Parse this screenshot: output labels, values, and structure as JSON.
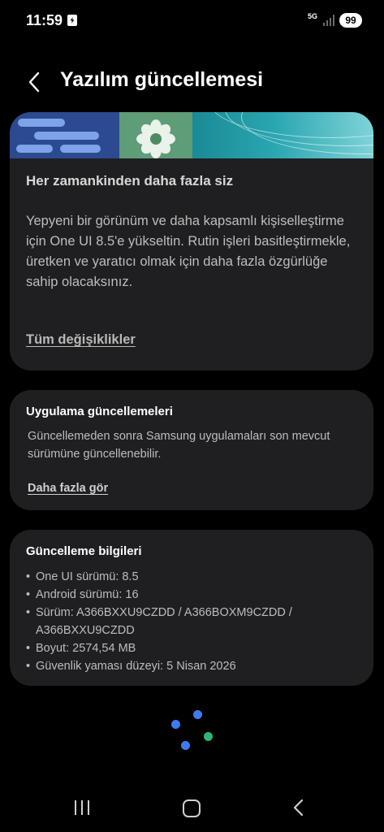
{
  "status_bar": {
    "time": "11:59",
    "network": "5G",
    "battery": "99",
    "notification_icon": "app-notification-icon"
  },
  "header": {
    "title": "Yazılım güncellemesi",
    "back_icon": "chevron-left-icon"
  },
  "main_card": {
    "heading": "Her zamankinden daha fazla siz",
    "body": "Yepyeni bir görünüm ve daha kapsamlı kişiselleştirme için One UI 8.5'e yükseltin. Rutin işleri basitleştirmekle, üretken ve yaratıcı olmak için daha fazla özgürlüğe sahip olacaksınız.",
    "link": "Tüm değişiklikler"
  },
  "apps_card": {
    "heading": "Uygulama güncellemeleri",
    "body": "Güncellemeden sonra Samsung uygulamaları son mevcut sürümüne güncellenebilir.",
    "link": "Daha fazla gör"
  },
  "info_card": {
    "heading": "Güncelleme bilgileri",
    "items": [
      "One UI sürümü: 8.5",
      "Android sürümü: 16",
      "Sürüm: A366BXXU9CZDD / A366BOXM9CZDD / A366BXXU9CZDD",
      "Boyut: 2574,54 MB",
      "Güvenlik yaması düzeyi: 5 Nisan 2026"
    ]
  },
  "colors": {
    "background": "#000000",
    "card": "#1f1f22",
    "spinner_blue": "#3d7cf0",
    "spinner_green": "#2fb47a"
  },
  "nav_bar": {
    "recents_icon": "recents-icon",
    "home_icon": "home-icon",
    "back_icon": "back-icon"
  }
}
